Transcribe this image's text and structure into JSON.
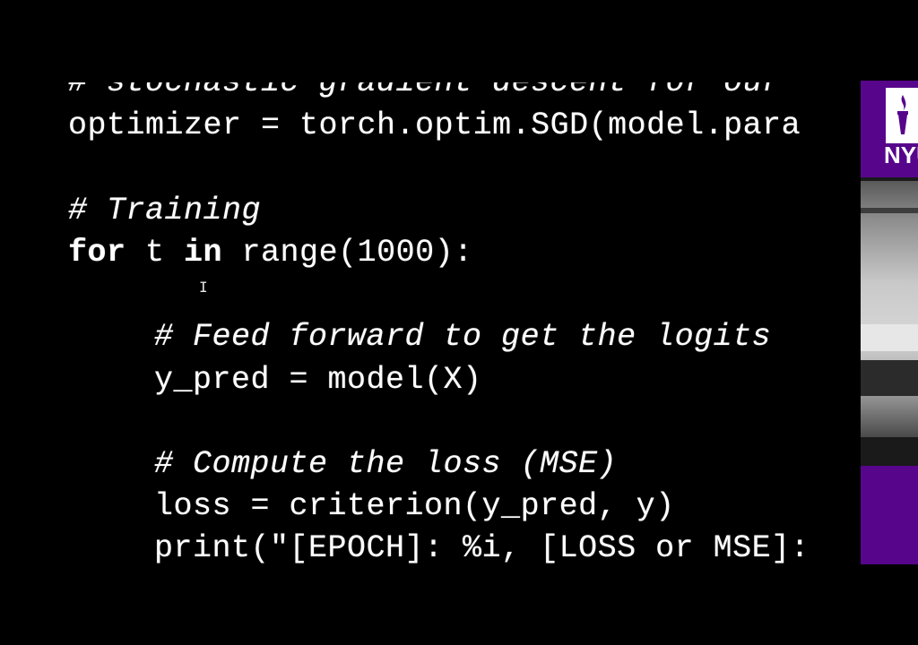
{
  "code": {
    "lines": [
      "# stochastic gradient descent for our",
      "optimizer = torch.optim.SGD(model.para",
      "# Training",
      "for",
      " t ",
      "in",
      " range(1000):",
      "# Feed forward to get the logits",
      "y_pred = model(X)",
      "# Compute the loss (MSE)",
      "loss = criterion(y_pred, y)",
      "print(\"[EPOCH]: %i, [LOSS or MSE]:"
    ]
  },
  "cursor": {
    "glyph": "I"
  },
  "overlay": {
    "logo_text": "NYU",
    "brand_color": "#57068c"
  }
}
